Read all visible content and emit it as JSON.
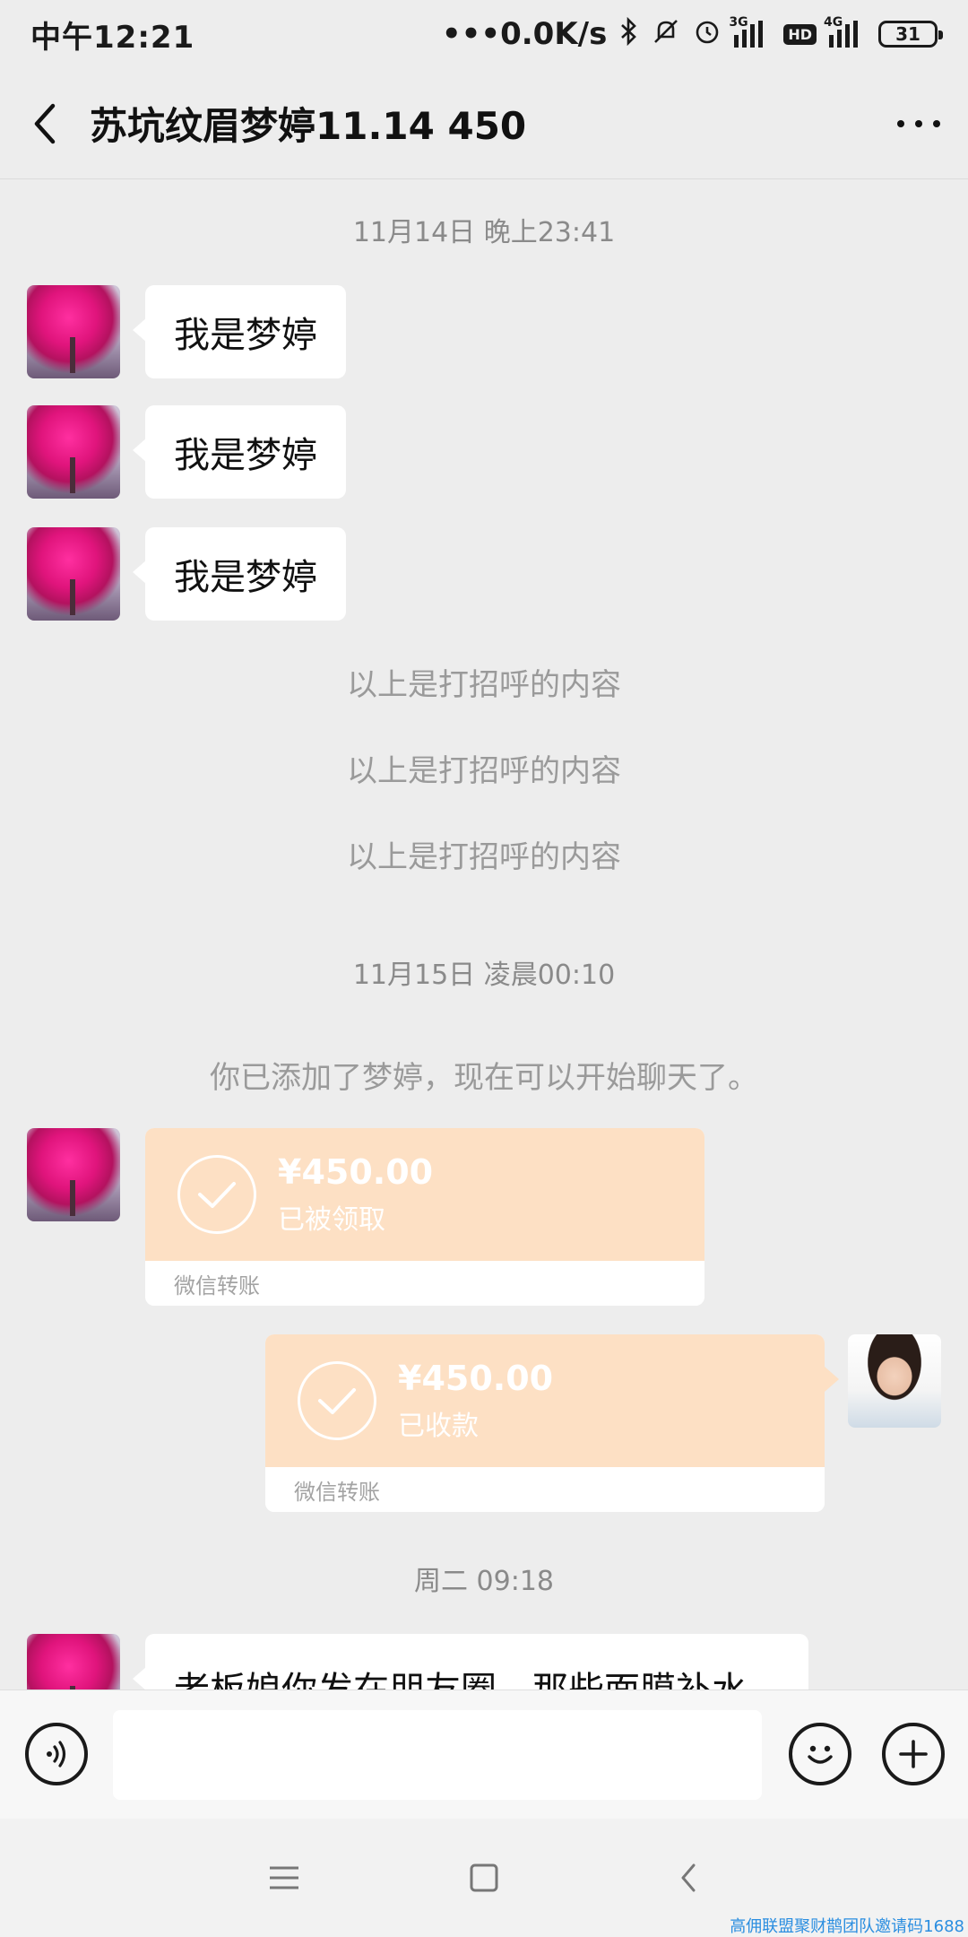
{
  "status_bar": {
    "time": "中午12:21",
    "net_speed": "0.0K/s",
    "net_3g": "3G",
    "net_4g": "4G",
    "hd": "HD",
    "battery": "31",
    "icons": [
      "bluetooth-icon",
      "mute-icon",
      "alarm-icon",
      "signal-icon",
      "hd-icon",
      "battery-icon"
    ]
  },
  "header": {
    "title": "苏坑纹眉梦婷11.14  450"
  },
  "chat": {
    "timestamp_1": "11月14日 晚上23:41",
    "greetings": [
      "我是梦婷",
      "我是梦婷",
      "我是梦婷"
    ],
    "system_notes": [
      "以上是打招呼的内容",
      "以上是打招呼的内容",
      "以上是打招呼的内容"
    ],
    "timestamp_2": "11月15日 凌晨00:10",
    "added_notice": "你已添加了梦婷，现在可以开始聊天了。",
    "transfer_received": {
      "amount": "¥450.00",
      "status": "已被领取",
      "label": "微信转账"
    },
    "transfer_sent": {
      "amount": "¥450.00",
      "status": "已收款",
      "label": "微信转账"
    },
    "timestamp_3": "周二 09:18",
    "last_message": "老板娘你发在朋友圈，那些面膜补水"
  },
  "input_bar": {
    "value": "",
    "placeholder": ""
  },
  "watermark": "高佣联盟聚财鹊团队邀请码1688",
  "colors": {
    "background": "#ededed",
    "transfer_bg": "#fde0c4",
    "bubble": "#ffffff"
  }
}
